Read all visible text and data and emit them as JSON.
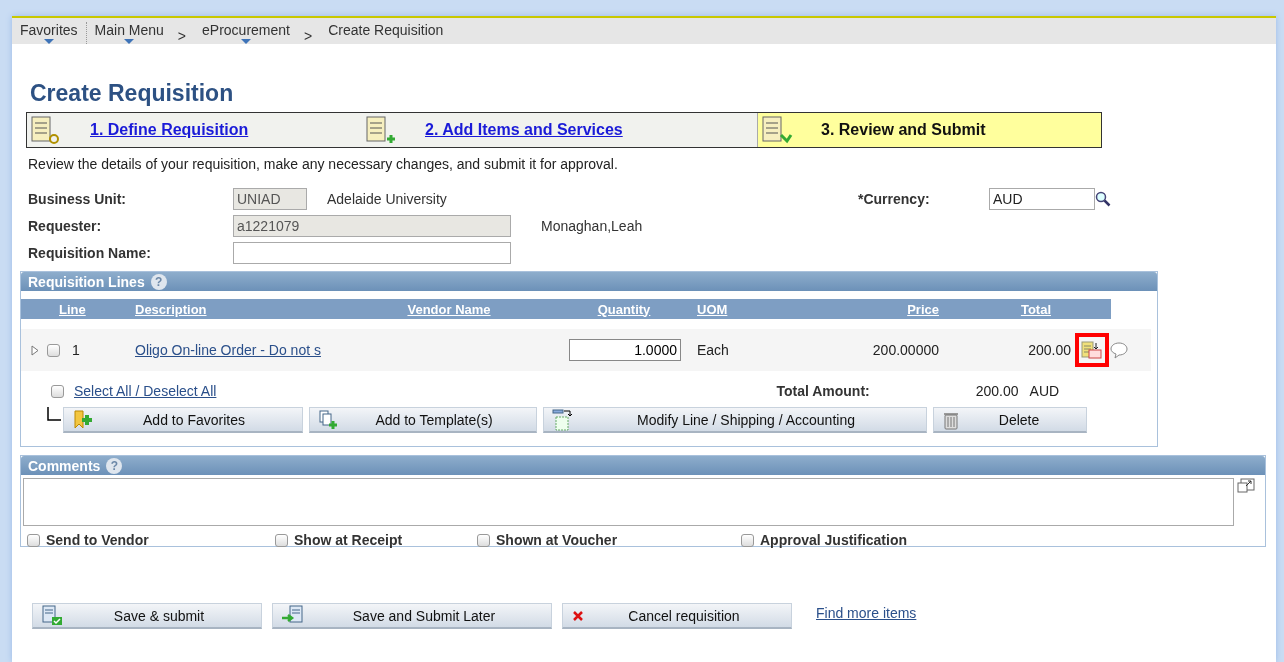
{
  "breadcrumbs": {
    "separator": ">",
    "items": [
      {
        "label": "Favorites",
        "dropdown": true
      },
      {
        "label": "Main Menu",
        "dropdown": true
      },
      {
        "label": "eProcurement",
        "dropdown": true
      },
      {
        "label": "Create Requisition",
        "dropdown": false
      }
    ]
  },
  "title": "Create Requisition",
  "steps": [
    {
      "label": "1. Define Requisition",
      "selected": false
    },
    {
      "label": "2. Add Items and Services",
      "selected": false
    },
    {
      "label": "3. Review and Submit",
      "selected": true
    }
  ],
  "instructions": "Review the details of your requisition, make any necessary changes, and submit it for approval.",
  "business_unit": {
    "label": "Business Unit:",
    "value": "UNIAD",
    "description": "Adelaide University",
    "disabled": true
  },
  "requester": {
    "label": "Requester:",
    "value": "a1221079",
    "description": "Monaghan,Leah",
    "disabled": true
  },
  "requisition_name": {
    "label": "Requisition Name:",
    "disabled": false
  },
  "currency": {
    "label": "*Currency:",
    "value": "AUD"
  },
  "requisition_lines": {
    "title": "Requisition Lines",
    "help": "?",
    "columns": [
      "Line",
      "Description",
      "Vendor Name",
      "Quantity",
      "UOM",
      "Price",
      "Total"
    ],
    "rows": [
      {
        "line": "1",
        "description": "Oligo On-line Order - Do not s",
        "quantity": "1.0000",
        "uom": "Each",
        "price": "200.00000",
        "total": "200.00",
        "checked": false,
        "highlighted": true
      }
    ],
    "select_all": {
      "label": "Select All / Deselect All",
      "checked": false
    },
    "total_label": "Total Amount:",
    "total_value": "200.00",
    "total_currency": "AUD",
    "buttons": [
      {
        "label": "Add to Favorites",
        "kind": "favorite"
      },
      {
        "label": "Add to Template(s)",
        "kind": "template"
      },
      {
        "label": "Modify Line / Shipping / Accounting",
        "kind": "modify"
      },
      {
        "label": "Delete",
        "kind": "delete"
      }
    ]
  },
  "comments": {
    "title": "Comments",
    "help": "?",
    "options": [
      {
        "label": "Send to Vendor",
        "checked": false
      },
      {
        "label": "Show at Receipt",
        "checked": false
      },
      {
        "label": "Shown at Voucher",
        "checked": false
      },
      {
        "label": "Approval Justification",
        "checked": false
      }
    ]
  },
  "actions": [
    {
      "label": "Save & submit",
      "kind": "submit"
    },
    {
      "label": "Save and Submit Later",
      "kind": "later"
    },
    {
      "label": "Cancel requisition",
      "kind": "cancel"
    }
  ],
  "find_link": "Find more items"
}
